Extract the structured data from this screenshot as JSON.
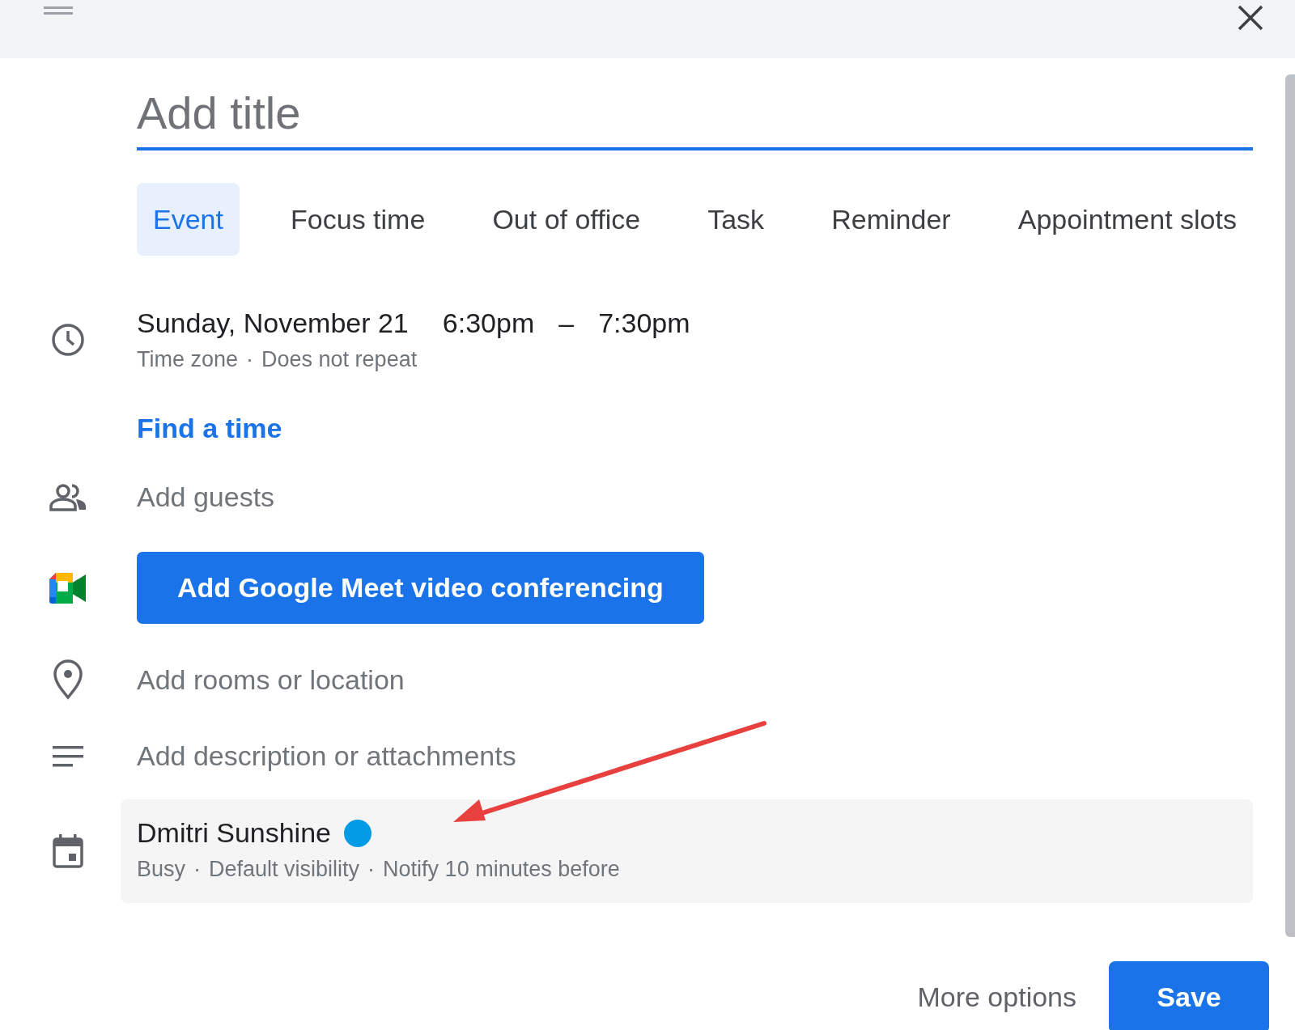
{
  "title_field": {
    "placeholder": "Add title"
  },
  "tabs": [
    {
      "label": "Event",
      "selected": true
    },
    {
      "label": "Focus time",
      "selected": false
    },
    {
      "label": "Out of office",
      "selected": false
    },
    {
      "label": "Task",
      "selected": false
    },
    {
      "label": "Reminder",
      "selected": false
    },
    {
      "label": "Appointment slots",
      "selected": false
    }
  ],
  "datetime": {
    "date": "Sunday, November 21",
    "start": "6:30pm",
    "separator": "–",
    "end": "7:30pm",
    "details": [
      "Time zone",
      "Does not repeat"
    ],
    "details_separator": "·"
  },
  "find_time_link": "Find a time",
  "guests": {
    "placeholder": "Add guests"
  },
  "meet_button": "Add Google Meet video conferencing",
  "location": {
    "placeholder": "Add rooms or location"
  },
  "description": {
    "placeholder": "Add description or attachments"
  },
  "calendar": {
    "name": "Dmitri Sunshine",
    "color": "#039be5",
    "details": [
      "Busy",
      "Default visibility",
      "Notify 10 minutes before"
    ],
    "separator": "·"
  },
  "footer": {
    "more_options": "More options",
    "save": "Save"
  }
}
